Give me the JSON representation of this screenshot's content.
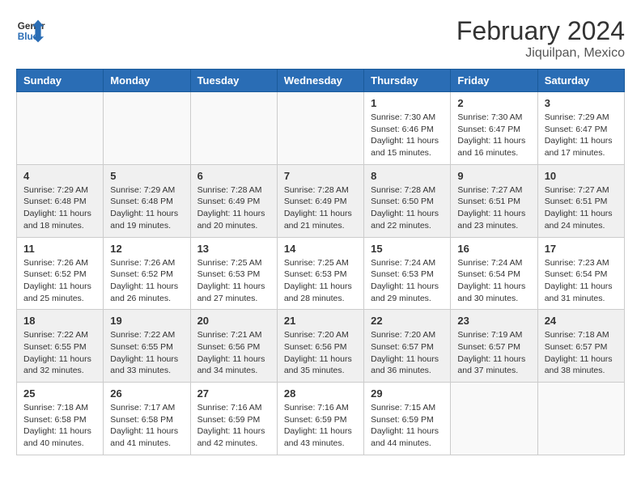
{
  "header": {
    "logo_line1": "General",
    "logo_line2": "Blue",
    "main_title": "February 2024",
    "subtitle": "Jiquilpan, Mexico"
  },
  "days_of_week": [
    "Sunday",
    "Monday",
    "Tuesday",
    "Wednesday",
    "Thursday",
    "Friday",
    "Saturday"
  ],
  "weeks": [
    [
      {
        "day": "",
        "info": ""
      },
      {
        "day": "",
        "info": ""
      },
      {
        "day": "",
        "info": ""
      },
      {
        "day": "",
        "info": ""
      },
      {
        "day": "1",
        "info": "Sunrise: 7:30 AM\nSunset: 6:46 PM\nDaylight: 11 hours and 15 minutes."
      },
      {
        "day": "2",
        "info": "Sunrise: 7:30 AM\nSunset: 6:47 PM\nDaylight: 11 hours and 16 minutes."
      },
      {
        "day": "3",
        "info": "Sunrise: 7:29 AM\nSunset: 6:47 PM\nDaylight: 11 hours and 17 minutes."
      }
    ],
    [
      {
        "day": "4",
        "info": "Sunrise: 7:29 AM\nSunset: 6:48 PM\nDaylight: 11 hours and 18 minutes."
      },
      {
        "day": "5",
        "info": "Sunrise: 7:29 AM\nSunset: 6:48 PM\nDaylight: 11 hours and 19 minutes."
      },
      {
        "day": "6",
        "info": "Sunrise: 7:28 AM\nSunset: 6:49 PM\nDaylight: 11 hours and 20 minutes."
      },
      {
        "day": "7",
        "info": "Sunrise: 7:28 AM\nSunset: 6:49 PM\nDaylight: 11 hours and 21 minutes."
      },
      {
        "day": "8",
        "info": "Sunrise: 7:28 AM\nSunset: 6:50 PM\nDaylight: 11 hours and 22 minutes."
      },
      {
        "day": "9",
        "info": "Sunrise: 7:27 AM\nSunset: 6:51 PM\nDaylight: 11 hours and 23 minutes."
      },
      {
        "day": "10",
        "info": "Sunrise: 7:27 AM\nSunset: 6:51 PM\nDaylight: 11 hours and 24 minutes."
      }
    ],
    [
      {
        "day": "11",
        "info": "Sunrise: 7:26 AM\nSunset: 6:52 PM\nDaylight: 11 hours and 25 minutes."
      },
      {
        "day": "12",
        "info": "Sunrise: 7:26 AM\nSunset: 6:52 PM\nDaylight: 11 hours and 26 minutes."
      },
      {
        "day": "13",
        "info": "Sunrise: 7:25 AM\nSunset: 6:53 PM\nDaylight: 11 hours and 27 minutes."
      },
      {
        "day": "14",
        "info": "Sunrise: 7:25 AM\nSunset: 6:53 PM\nDaylight: 11 hours and 28 minutes."
      },
      {
        "day": "15",
        "info": "Sunrise: 7:24 AM\nSunset: 6:53 PM\nDaylight: 11 hours and 29 minutes."
      },
      {
        "day": "16",
        "info": "Sunrise: 7:24 AM\nSunset: 6:54 PM\nDaylight: 11 hours and 30 minutes."
      },
      {
        "day": "17",
        "info": "Sunrise: 7:23 AM\nSunset: 6:54 PM\nDaylight: 11 hours and 31 minutes."
      }
    ],
    [
      {
        "day": "18",
        "info": "Sunrise: 7:22 AM\nSunset: 6:55 PM\nDaylight: 11 hours and 32 minutes."
      },
      {
        "day": "19",
        "info": "Sunrise: 7:22 AM\nSunset: 6:55 PM\nDaylight: 11 hours and 33 minutes."
      },
      {
        "day": "20",
        "info": "Sunrise: 7:21 AM\nSunset: 6:56 PM\nDaylight: 11 hours and 34 minutes."
      },
      {
        "day": "21",
        "info": "Sunrise: 7:20 AM\nSunset: 6:56 PM\nDaylight: 11 hours and 35 minutes."
      },
      {
        "day": "22",
        "info": "Sunrise: 7:20 AM\nSunset: 6:57 PM\nDaylight: 11 hours and 36 minutes."
      },
      {
        "day": "23",
        "info": "Sunrise: 7:19 AM\nSunset: 6:57 PM\nDaylight: 11 hours and 37 minutes."
      },
      {
        "day": "24",
        "info": "Sunrise: 7:18 AM\nSunset: 6:57 PM\nDaylight: 11 hours and 38 minutes."
      }
    ],
    [
      {
        "day": "25",
        "info": "Sunrise: 7:18 AM\nSunset: 6:58 PM\nDaylight: 11 hours and 40 minutes."
      },
      {
        "day": "26",
        "info": "Sunrise: 7:17 AM\nSunset: 6:58 PM\nDaylight: 11 hours and 41 minutes."
      },
      {
        "day": "27",
        "info": "Sunrise: 7:16 AM\nSunset: 6:59 PM\nDaylight: 11 hours and 42 minutes."
      },
      {
        "day": "28",
        "info": "Sunrise: 7:16 AM\nSunset: 6:59 PM\nDaylight: 11 hours and 43 minutes."
      },
      {
        "day": "29",
        "info": "Sunrise: 7:15 AM\nSunset: 6:59 PM\nDaylight: 11 hours and 44 minutes."
      },
      {
        "day": "",
        "info": ""
      },
      {
        "day": "",
        "info": ""
      }
    ]
  ]
}
